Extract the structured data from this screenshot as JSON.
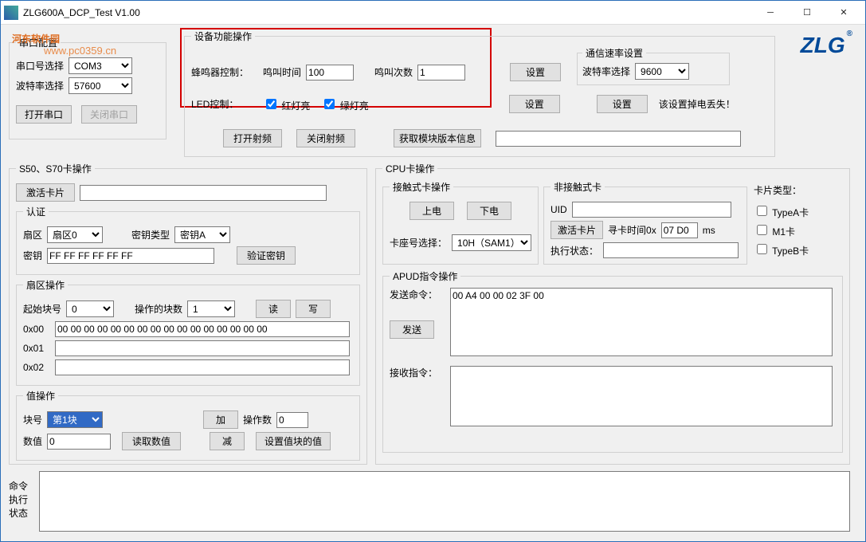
{
  "window": {
    "title": "ZLG600A_DCP_Test V1.00"
  },
  "watermark": {
    "brand": "河东软件园",
    "url": "www.pc0359.cn"
  },
  "serialCfg": {
    "legend": "串口配置",
    "portLabel": "串口号选择",
    "portValue": "COM3",
    "baudLabel": "波特率选择",
    "baudValue": "57600",
    "openBtn": "打开串口",
    "closeBtn": "关闭串口"
  },
  "devFunc": {
    "legend": "设备功能操作",
    "buzzerLabel": "蜂鸣器控制：",
    "buzzTimeLabel": "鸣叫时间",
    "buzzTimeValue": "100",
    "buzzCountLabel": "鸣叫次数",
    "buzzCountValue": "1",
    "ledLabel": "LED控制：",
    "redLed": "红灯亮",
    "greenLed": "绿灯亮",
    "setBtn": "设置"
  },
  "commRate": {
    "legend": "通信速率设置",
    "baudLabel": "波特率选择",
    "baudValue": "9600",
    "setBtn": "设置",
    "note": "该设置掉电丢失！"
  },
  "rfBtns": {
    "openRf": "打开射频",
    "closeRf": "关闭射频",
    "getVersion": "获取模块版本信息",
    "versionValue": ""
  },
  "s50s70": {
    "legend": "S50、S70卡操作",
    "activateBtn": "激活卡片",
    "activateValue": "",
    "auth": {
      "legend": "认证",
      "sectorLabel": "扇区",
      "sectorValue": "扇区0",
      "keyTypeLabel": "密钥类型",
      "keyTypeValue": "密钥A",
      "keyLabel": "密钥",
      "keyValue": "FF FF FF FF FF FF",
      "verifyBtn": "验证密钥"
    },
    "sectorOp": {
      "legend": "扇区操作",
      "startBlockLabel": "起始块号",
      "startBlockValue": "0",
      "blockCountLabel": "操作的块数",
      "blockCountValue": "1",
      "readBtn": "读",
      "writeBtn": "写",
      "row0Label": "0x00",
      "row0Value": "00 00 00 00 00 00 00 00 00 00 00 00 00 00 00 00",
      "row1Label": "0x01",
      "row1Value": "",
      "row2Label": "0x02",
      "row2Value": ""
    },
    "valueOp": {
      "legend": "值操作",
      "blockLabel": "块号",
      "blockValue": "第1块",
      "addBtn": "加",
      "opCountLabel": "操作数",
      "opCountValue": "0",
      "valLabel": "数值",
      "valValue": "0",
      "readValBtn": "读取数值",
      "subBtn": "减",
      "setBlockBtn": "设置值块的值"
    }
  },
  "cpu": {
    "legend": "CPU卡操作",
    "contact": {
      "legend": "接触式卡操作",
      "powerOnBtn": "上电",
      "powerOffBtn": "下电",
      "slotLabel": "卡座号选择：",
      "slotValue": "10H（SAM1）"
    },
    "contactless": {
      "legend": "非接触式卡",
      "uidLabel": "UID",
      "uidValue": "",
      "activateBtn": "激活卡片",
      "seekTimeLabel": "寻卡时间0x",
      "seekTimeValue": "07 D0",
      "msLabel": "ms",
      "execStatusLabel": "执行状态：",
      "execStatusValue": ""
    },
    "cardType": {
      "legend": "卡片类型：",
      "typeA": "TypeA卡",
      "m1": "M1卡",
      "typeB": "TypeB卡"
    },
    "apdu": {
      "legend": "APUD指令操作",
      "sendLabel": "发送命令：",
      "sendValue": "00 A4 00 00 02 3F 00",
      "sendBtn": "发送",
      "recvLabel": "接收指令：",
      "recvValue": ""
    }
  },
  "cmdStatus": {
    "label": "命令\n执行\n状态"
  }
}
